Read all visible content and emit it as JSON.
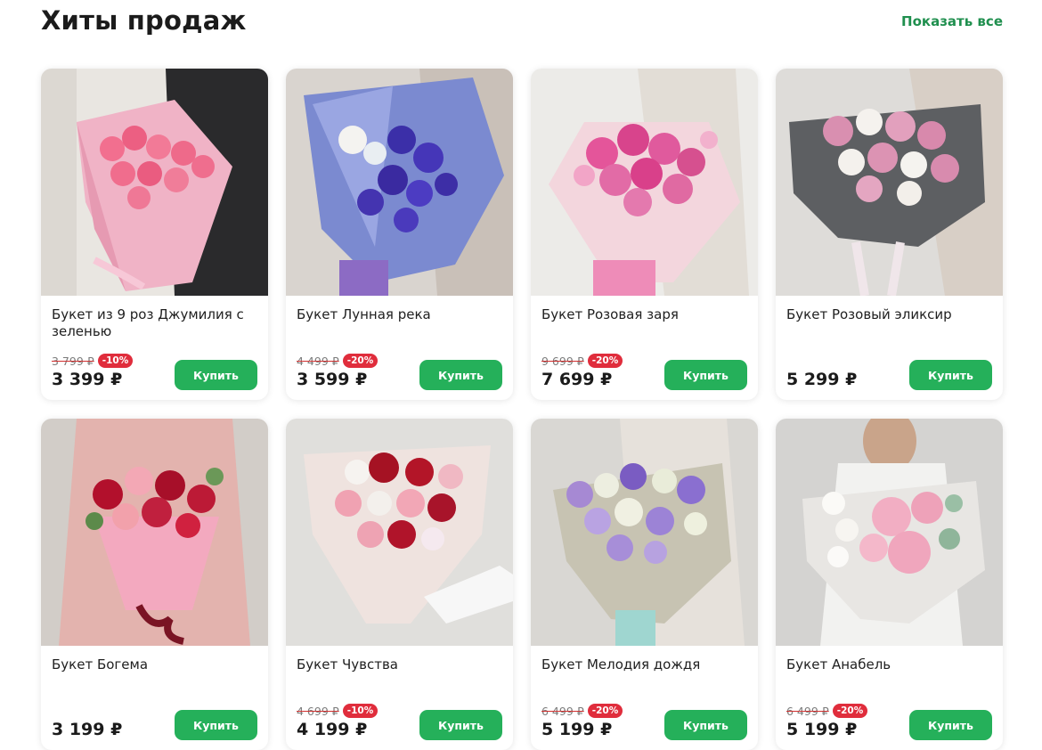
{
  "section": {
    "title": "Хиты продаж",
    "show_all_label": "Показать все"
  },
  "colors": {
    "accent_green": "#25b05a",
    "link_green": "#1f8f4e",
    "discount_red": "#e02d3c"
  },
  "products": [
    {
      "name": "Букет из 9 роз Джумилия с зеленью",
      "old_price": "3 799 ₽",
      "discount": "-10%",
      "price": "3 399 ₽",
      "buy_label": "Купить"
    },
    {
      "name": "Букет Лунная река",
      "old_price": "4 499 ₽",
      "discount": "-20%",
      "price": "3 599 ₽",
      "buy_label": "Купить"
    },
    {
      "name": "Букет Розовая заря",
      "old_price": "9 699 ₽",
      "discount": "-20%",
      "price": "7 699 ₽",
      "buy_label": "Купить"
    },
    {
      "name": "Букет Розовый эликсир",
      "old_price": "",
      "discount": "",
      "price": "5 299 ₽",
      "buy_label": "Купить"
    },
    {
      "name": "Букет Богема",
      "old_price": "",
      "discount": "",
      "price": "3 199 ₽",
      "buy_label": "Купить"
    },
    {
      "name": "Букет Чувства",
      "old_price": "4 699 ₽",
      "discount": "-10%",
      "price": "4 199 ₽",
      "buy_label": "Купить"
    },
    {
      "name": "Букет Мелодия дождя",
      "old_price": "6 499 ₽",
      "discount": "-20%",
      "price": "5 199 ₽",
      "buy_label": "Купить"
    },
    {
      "name": "Букет Анабель",
      "old_price": "6 499 ₽",
      "discount": "-20%",
      "price": "5 199 ₽",
      "buy_label": "Купить"
    }
  ]
}
